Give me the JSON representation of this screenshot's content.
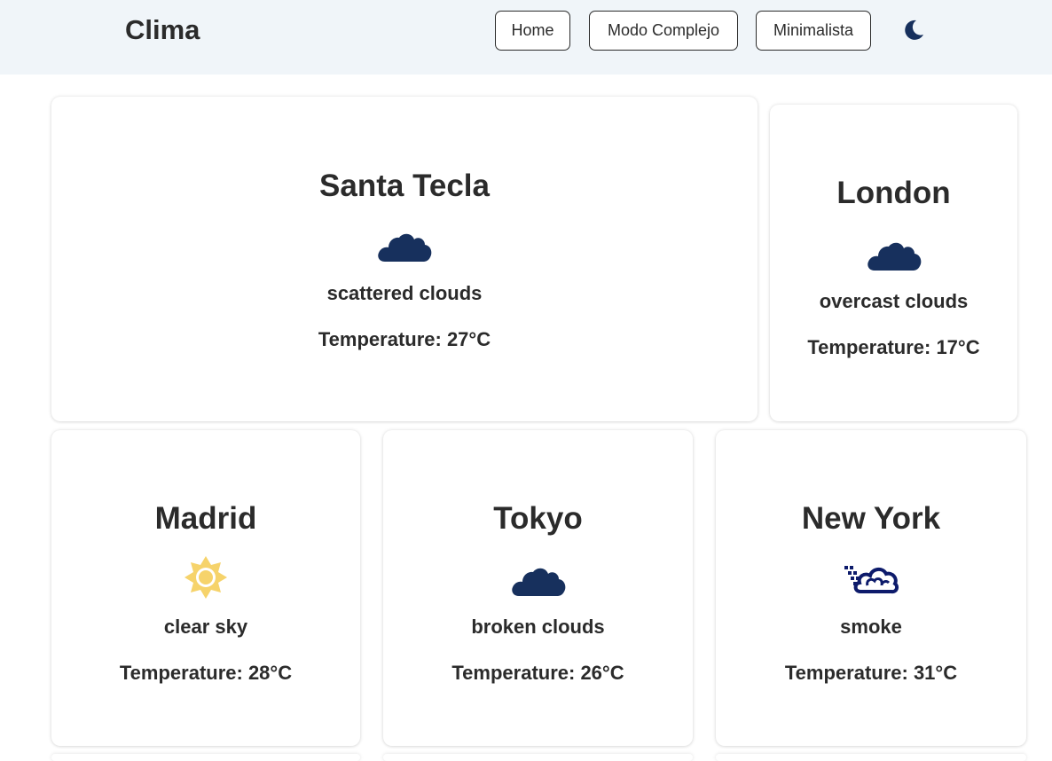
{
  "header": {
    "title": "Clima",
    "nav": [
      {
        "label": "Home"
      },
      {
        "label": "Modo Complejo"
      },
      {
        "label": "Minimalista"
      }
    ],
    "theme_toggle_icon": "moon-icon"
  },
  "cards": [
    {
      "city": "Santa Tecla",
      "icon": "cloud-icon",
      "description": "scattered clouds",
      "temperature": "Temperature: 27°C"
    },
    {
      "city": "London",
      "icon": "cloud-icon",
      "description": "overcast clouds",
      "temperature": "Temperature: 17°C"
    },
    {
      "city": "Madrid",
      "icon": "sun-icon",
      "description": "clear sky",
      "temperature": "Temperature: 28°C"
    },
    {
      "city": "Tokyo",
      "icon": "cloud-icon",
      "description": "broken clouds",
      "temperature": "Temperature: 26°C"
    },
    {
      "city": "New York",
      "icon": "smoke-icon",
      "description": "smoke",
      "temperature": "Temperature: 31°C"
    }
  ],
  "colors": {
    "header_bg": "#f0f5f9",
    "cloud": "#17305d",
    "sun": "#f6d36b",
    "smoke": "#0d1b6b",
    "text": "#2b2b2b"
  }
}
